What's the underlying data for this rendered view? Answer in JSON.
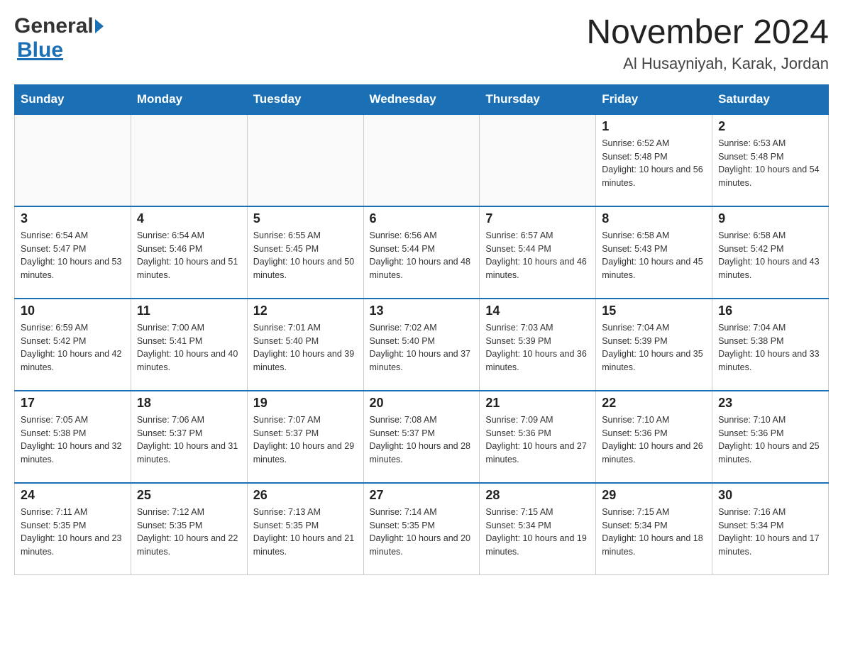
{
  "logo": {
    "general": "General",
    "blue": "Blue"
  },
  "title": {
    "month_year": "November 2024",
    "location": "Al Husayniyah, Karak, Jordan"
  },
  "days_of_week": [
    "Sunday",
    "Monday",
    "Tuesday",
    "Wednesday",
    "Thursday",
    "Friday",
    "Saturday"
  ],
  "weeks": [
    [
      {
        "day": "",
        "info": ""
      },
      {
        "day": "",
        "info": ""
      },
      {
        "day": "",
        "info": ""
      },
      {
        "day": "",
        "info": ""
      },
      {
        "day": "",
        "info": ""
      },
      {
        "day": "1",
        "info": "Sunrise: 6:52 AM\nSunset: 5:48 PM\nDaylight: 10 hours and 56 minutes."
      },
      {
        "day": "2",
        "info": "Sunrise: 6:53 AM\nSunset: 5:48 PM\nDaylight: 10 hours and 54 minutes."
      }
    ],
    [
      {
        "day": "3",
        "info": "Sunrise: 6:54 AM\nSunset: 5:47 PM\nDaylight: 10 hours and 53 minutes."
      },
      {
        "day": "4",
        "info": "Sunrise: 6:54 AM\nSunset: 5:46 PM\nDaylight: 10 hours and 51 minutes."
      },
      {
        "day": "5",
        "info": "Sunrise: 6:55 AM\nSunset: 5:45 PM\nDaylight: 10 hours and 50 minutes."
      },
      {
        "day": "6",
        "info": "Sunrise: 6:56 AM\nSunset: 5:44 PM\nDaylight: 10 hours and 48 minutes."
      },
      {
        "day": "7",
        "info": "Sunrise: 6:57 AM\nSunset: 5:44 PM\nDaylight: 10 hours and 46 minutes."
      },
      {
        "day": "8",
        "info": "Sunrise: 6:58 AM\nSunset: 5:43 PM\nDaylight: 10 hours and 45 minutes."
      },
      {
        "day": "9",
        "info": "Sunrise: 6:58 AM\nSunset: 5:42 PM\nDaylight: 10 hours and 43 minutes."
      }
    ],
    [
      {
        "day": "10",
        "info": "Sunrise: 6:59 AM\nSunset: 5:42 PM\nDaylight: 10 hours and 42 minutes."
      },
      {
        "day": "11",
        "info": "Sunrise: 7:00 AM\nSunset: 5:41 PM\nDaylight: 10 hours and 40 minutes."
      },
      {
        "day": "12",
        "info": "Sunrise: 7:01 AM\nSunset: 5:40 PM\nDaylight: 10 hours and 39 minutes."
      },
      {
        "day": "13",
        "info": "Sunrise: 7:02 AM\nSunset: 5:40 PM\nDaylight: 10 hours and 37 minutes."
      },
      {
        "day": "14",
        "info": "Sunrise: 7:03 AM\nSunset: 5:39 PM\nDaylight: 10 hours and 36 minutes."
      },
      {
        "day": "15",
        "info": "Sunrise: 7:04 AM\nSunset: 5:39 PM\nDaylight: 10 hours and 35 minutes."
      },
      {
        "day": "16",
        "info": "Sunrise: 7:04 AM\nSunset: 5:38 PM\nDaylight: 10 hours and 33 minutes."
      }
    ],
    [
      {
        "day": "17",
        "info": "Sunrise: 7:05 AM\nSunset: 5:38 PM\nDaylight: 10 hours and 32 minutes."
      },
      {
        "day": "18",
        "info": "Sunrise: 7:06 AM\nSunset: 5:37 PM\nDaylight: 10 hours and 31 minutes."
      },
      {
        "day": "19",
        "info": "Sunrise: 7:07 AM\nSunset: 5:37 PM\nDaylight: 10 hours and 29 minutes."
      },
      {
        "day": "20",
        "info": "Sunrise: 7:08 AM\nSunset: 5:37 PM\nDaylight: 10 hours and 28 minutes."
      },
      {
        "day": "21",
        "info": "Sunrise: 7:09 AM\nSunset: 5:36 PM\nDaylight: 10 hours and 27 minutes."
      },
      {
        "day": "22",
        "info": "Sunrise: 7:10 AM\nSunset: 5:36 PM\nDaylight: 10 hours and 26 minutes."
      },
      {
        "day": "23",
        "info": "Sunrise: 7:10 AM\nSunset: 5:36 PM\nDaylight: 10 hours and 25 minutes."
      }
    ],
    [
      {
        "day": "24",
        "info": "Sunrise: 7:11 AM\nSunset: 5:35 PM\nDaylight: 10 hours and 23 minutes."
      },
      {
        "day": "25",
        "info": "Sunrise: 7:12 AM\nSunset: 5:35 PM\nDaylight: 10 hours and 22 minutes."
      },
      {
        "day": "26",
        "info": "Sunrise: 7:13 AM\nSunset: 5:35 PM\nDaylight: 10 hours and 21 minutes."
      },
      {
        "day": "27",
        "info": "Sunrise: 7:14 AM\nSunset: 5:35 PM\nDaylight: 10 hours and 20 minutes."
      },
      {
        "day": "28",
        "info": "Sunrise: 7:15 AM\nSunset: 5:34 PM\nDaylight: 10 hours and 19 minutes."
      },
      {
        "day": "29",
        "info": "Sunrise: 7:15 AM\nSunset: 5:34 PM\nDaylight: 10 hours and 18 minutes."
      },
      {
        "day": "30",
        "info": "Sunrise: 7:16 AM\nSunset: 5:34 PM\nDaylight: 10 hours and 17 minutes."
      }
    ]
  ]
}
